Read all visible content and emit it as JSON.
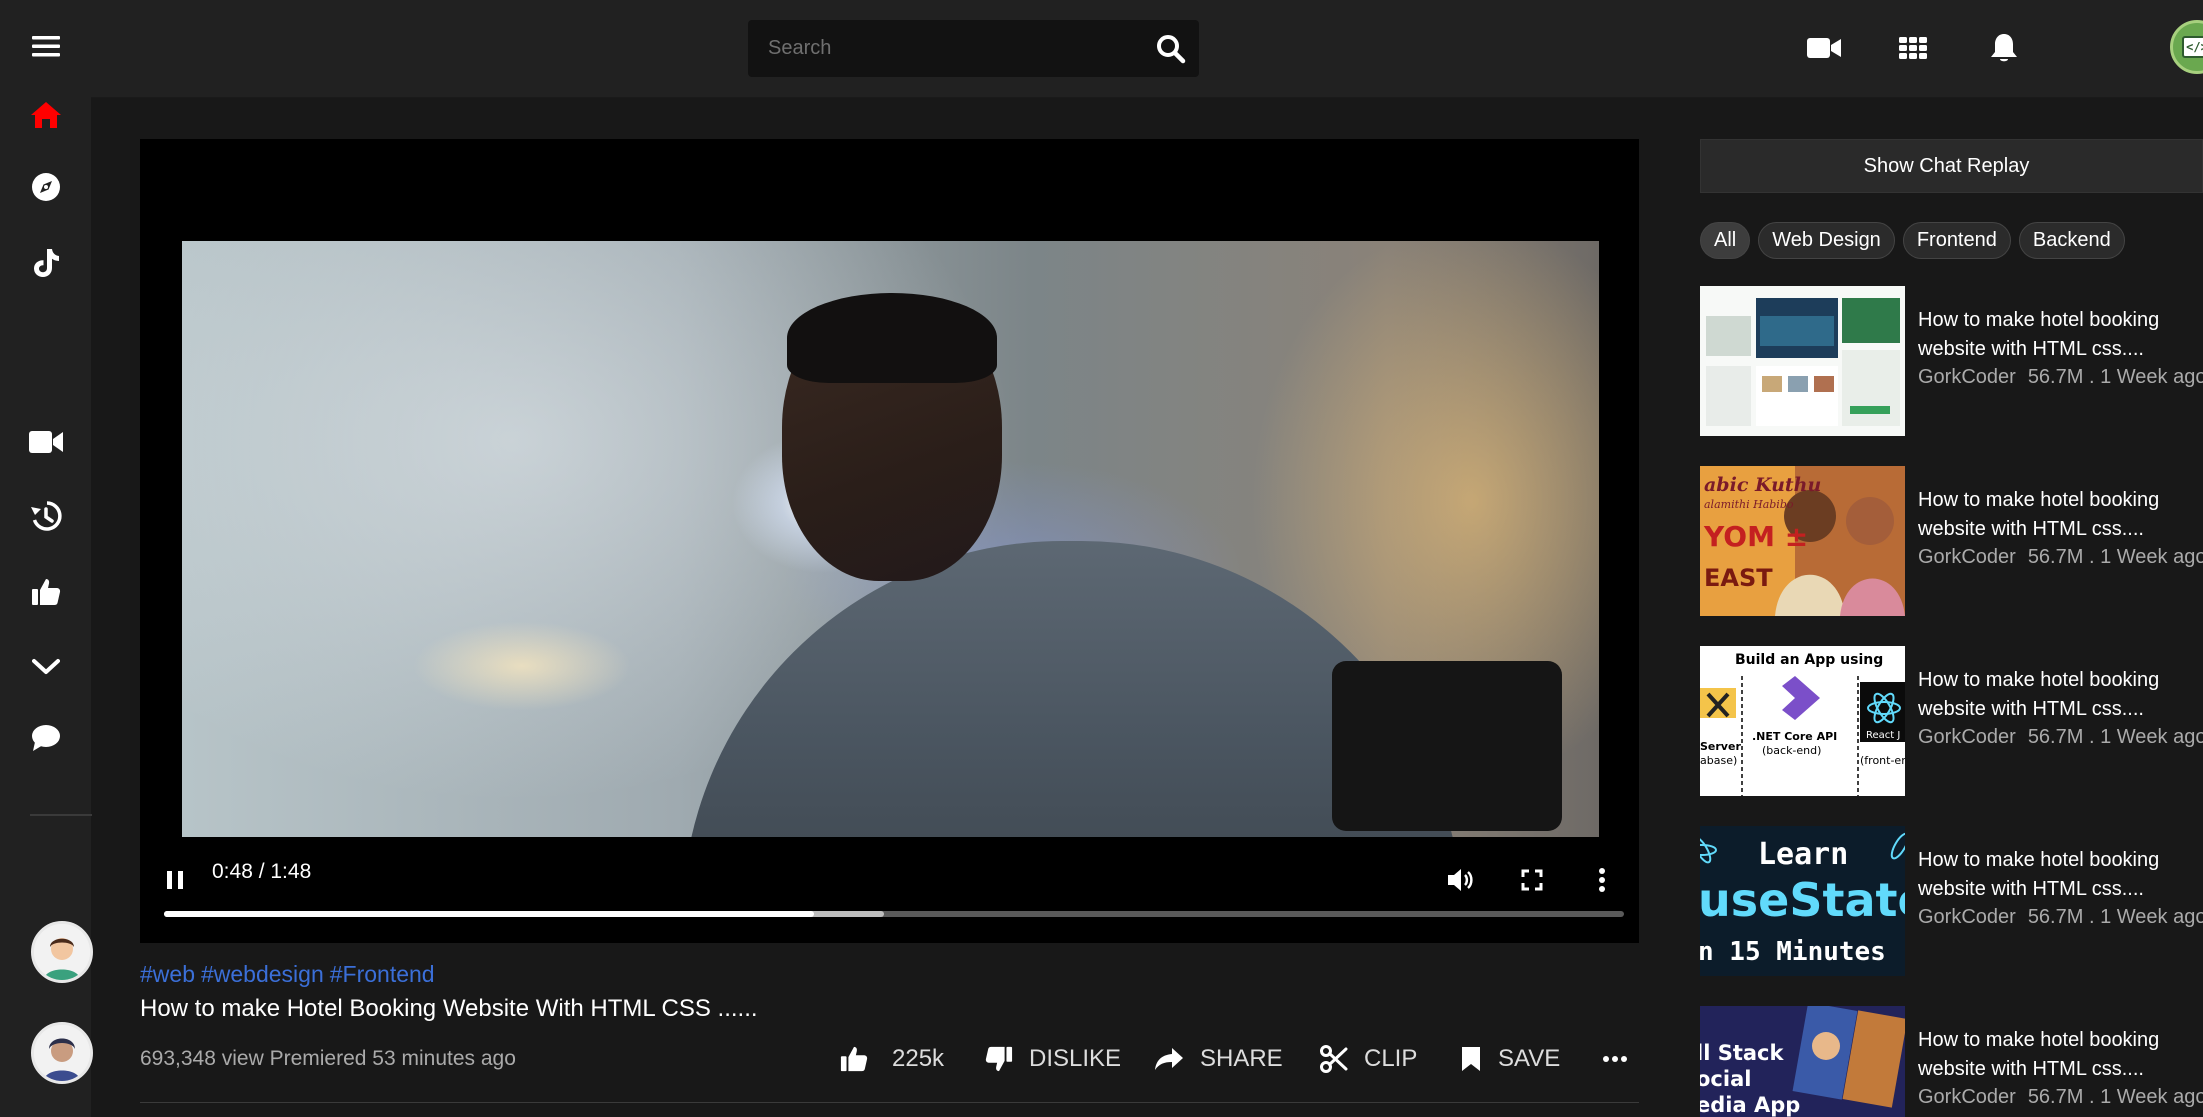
{
  "search": {
    "placeholder": "Search"
  },
  "player": {
    "current_time": "0:48",
    "duration": "1:48",
    "time_display": "0:48 / 1:48",
    "played_fraction": 0.445,
    "buffered_fraction": 0.493,
    "state": "playing"
  },
  "video": {
    "tags": [
      "#web",
      "#webdesign",
      "#Frontend"
    ],
    "title": "How to make Hotel Booking Website With HTML CSS ......",
    "views_text": "693,348 view Premiered 53 minutes ago",
    "like_count": "225k",
    "dislike_label": "DISLIKE",
    "share_label": "SHARE",
    "clip_label": "CLIP",
    "save_label": "SAVE"
  },
  "sidebar": {
    "icons": [
      "menu-icon",
      "home-icon",
      "explore-icon",
      "tiktok-icon",
      "video-camera-icon",
      "history-icon",
      "thumbs-up-icon",
      "chevron-down-icon",
      "chat-bubble-icon"
    ]
  },
  "chat_replay_label": "Show Chat Replay",
  "chips": [
    "All",
    "Web Design",
    "Frontend",
    "Backend"
  ],
  "recommendations": [
    {
      "title": "How to make hotel booking website with HTML css....",
      "channel": "GorkCoder",
      "meta": "56.7M . 1 Week ago"
    },
    {
      "title": "How to make hotel booking website with HTML css....",
      "channel": "GorkCoder",
      "meta": "56.7M . 1 Week ago",
      "thumb_text": [
        "abic Kuthu",
        "alamithi Habibo",
        "YOM ±",
        "EAST"
      ]
    },
    {
      "title": "How to make hotel booking website with HTML css....",
      "channel": "GorkCoder",
      "meta": "56.7M . 1 Week ago",
      "thumb_text": [
        "Build an App using",
        ".NET Core API",
        "(back-end)",
        "React J",
        "(front-en",
        "Server",
        "abase)"
      ]
    },
    {
      "title": "How to make hotel booking website with HTML css....",
      "channel": "GorkCoder",
      "meta": "56.7M . 1 Week ago",
      "thumb_text": [
        "Learn",
        "useState",
        "n 15 Minutes"
      ]
    },
    {
      "title": "How to make hotel booking website with HTML css....",
      "channel": "GorkCoder",
      "meta": "56.7M . 1 Week ago",
      "thumb_text": [
        "ll Stack",
        "ocial",
        "edia App"
      ]
    }
  ],
  "colors": {
    "accent_red": "#ff0000",
    "tag_blue": "#3b6fd8",
    "bg": "#181818",
    "panel": "#212121"
  }
}
